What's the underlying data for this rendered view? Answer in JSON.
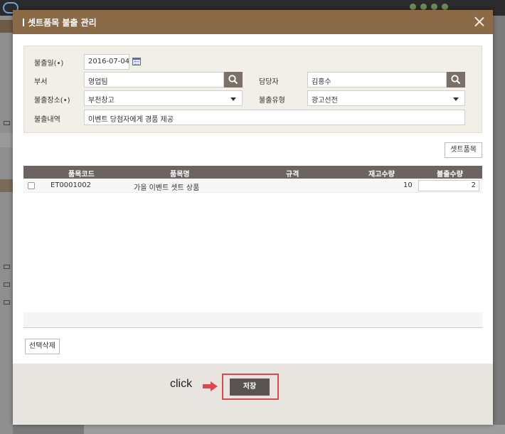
{
  "dialog": {
    "title": "셋트품목 불출 관리"
  },
  "form": {
    "date_label": "불출일(•)",
    "date_value": "2016-07-04",
    "dept_label": "부서",
    "dept_value": "영업팀",
    "manager_label": "담당자",
    "manager_value": "김홍수",
    "location_label": "불출장소(•)",
    "location_value": "부천창고",
    "type_label": "불출유형",
    "type_value": "광고선전",
    "desc_label": "불출내역",
    "desc_value": "이벤트 당첨자에게 경품 제공"
  },
  "toolbar": {
    "set_item_label": "셋트품목"
  },
  "grid": {
    "columns": [
      "품목코드",
      "품목명",
      "규격",
      "재고수량",
      "불출수량"
    ],
    "rows": [
      {
        "code": "ET0001002",
        "name": "가을 이벤트 셋트 상품",
        "spec": "",
        "stock": "10",
        "qty": "2"
      }
    ]
  },
  "actions": {
    "delete_label": "선택삭제",
    "save_label": "저장",
    "click_hint": "click"
  },
  "colors": {
    "header": "#8b6a47",
    "save_button": "#5a5351",
    "highlight": "#e0474a"
  }
}
